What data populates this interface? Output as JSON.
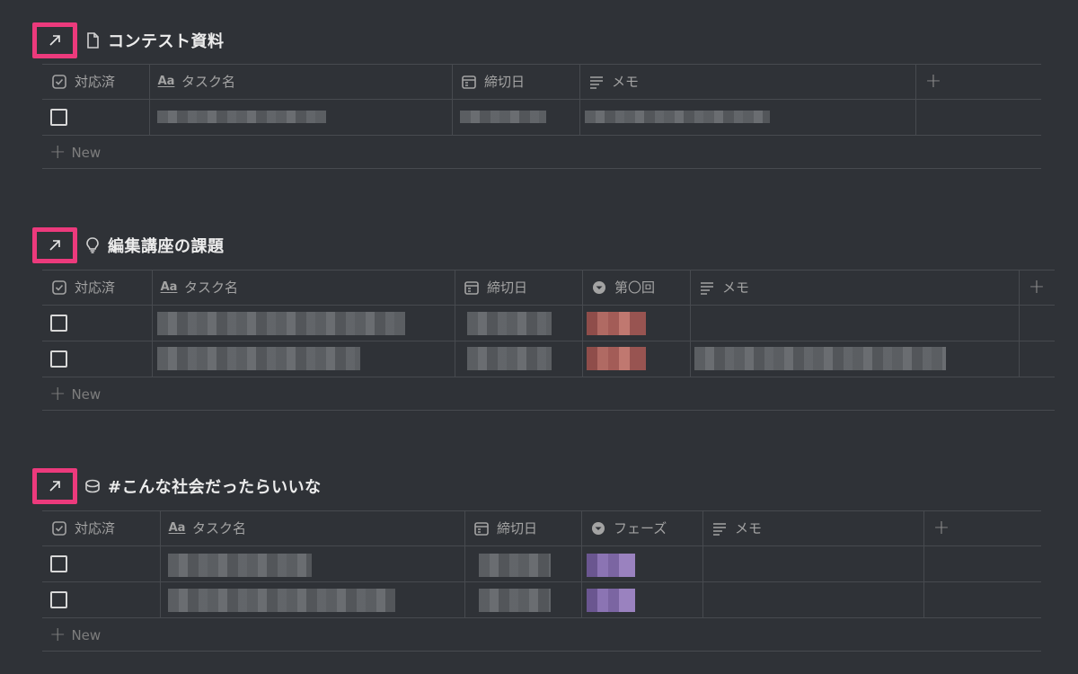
{
  "new_label": "New",
  "add_column_glyph": "+",
  "colors": {
    "highlight": "#ec3a7c",
    "background": "#2f3237",
    "tag_red": "#b06a63",
    "tag_purple": "#8b74b3"
  },
  "sections": [
    {
      "title": "コンテスト資料",
      "page_icon": "document-icon",
      "columns": [
        {
          "label": "対応済",
          "icon": "checkbox-icon"
        },
        {
          "label": "タスク名",
          "icon": "Aa"
        },
        {
          "label": "締切日",
          "icon": "calendar-icon"
        },
        {
          "label": "メモ",
          "icon": "text-lines-icon"
        }
      ],
      "rows": [
        {
          "checked": false
        }
      ]
    },
    {
      "title": "編集講座の課題",
      "page_icon": "lightbulb-icon",
      "columns": [
        {
          "label": "対応済",
          "icon": "checkbox-icon"
        },
        {
          "label": "タスク名",
          "icon": "Aa"
        },
        {
          "label": "締切日",
          "icon": "calendar-icon"
        },
        {
          "label": "第〇回",
          "icon": "select-icon"
        },
        {
          "label": "メモ",
          "icon": "text-lines-icon"
        }
      ],
      "rows": [
        {
          "checked": false
        },
        {
          "checked": false
        }
      ]
    },
    {
      "title": "#こんな社会だったらいいな",
      "page_icon": "coins-icon",
      "columns": [
        {
          "label": "対応済",
          "icon": "checkbox-icon"
        },
        {
          "label": "タスク名",
          "icon": "Aa"
        },
        {
          "label": "締切日",
          "icon": "calendar-icon"
        },
        {
          "label": "フェーズ",
          "icon": "select-icon"
        },
        {
          "label": "メモ",
          "icon": "text-lines-icon"
        }
      ],
      "rows": [
        {
          "checked": false
        },
        {
          "checked": false
        }
      ]
    }
  ]
}
